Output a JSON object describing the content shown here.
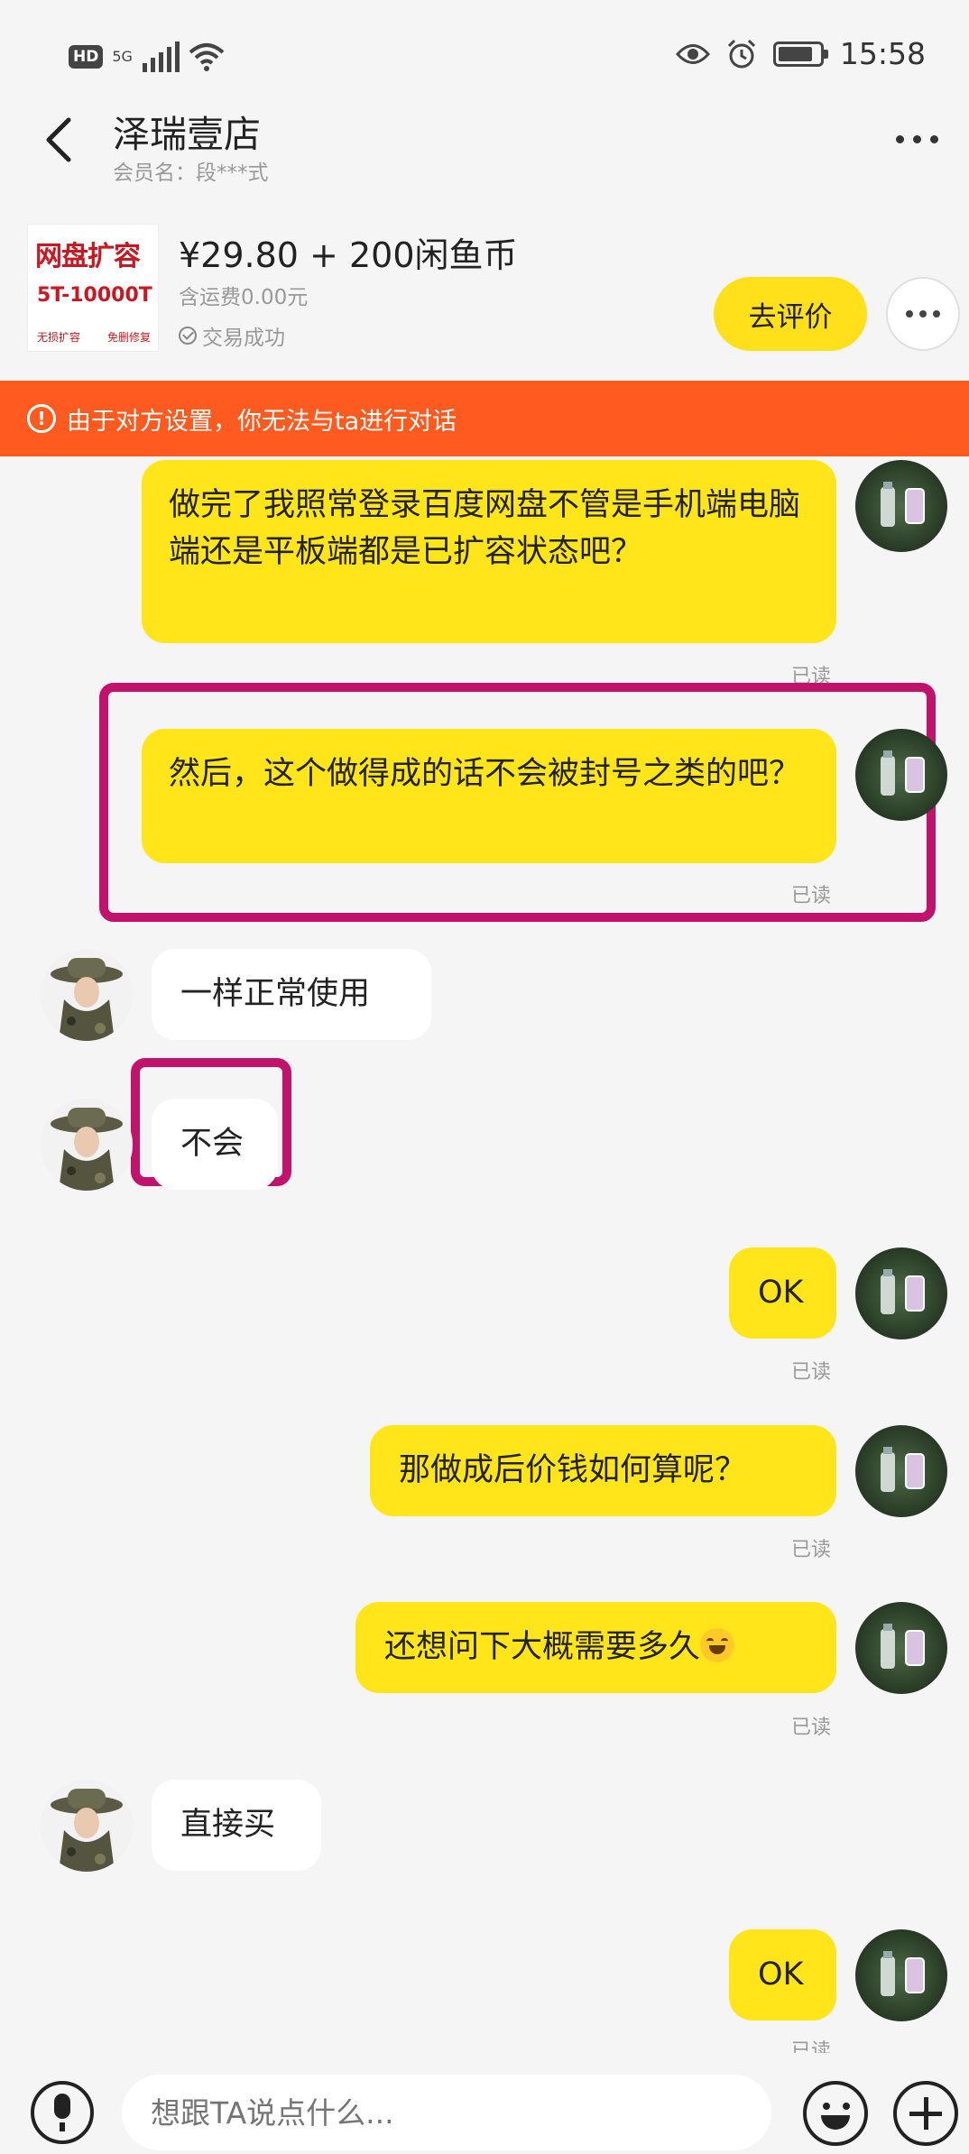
{
  "status_bar": {
    "hd": "HD",
    "network": "5G",
    "time": "15:58",
    "battery_level": 0.85
  },
  "header": {
    "title": "泽瑞壹店",
    "member_label": "会员名：段***式"
  },
  "product": {
    "thumb_title": "网盘扩容",
    "thumb_capacity": "5T-10000T",
    "thumb_left_note": "无损扩容",
    "thumb_right_note": "免删修复",
    "price": "¥29.80 + 200闲鱼币",
    "shipping": "含运费0.00元",
    "deal_status": "交易成功",
    "review_button": "去评价"
  },
  "banner": {
    "text": "由于对方设置，你无法与ta进行对话"
  },
  "messages": [
    {
      "side": "me",
      "text": "做完了我照常登录百度网盘不管是手机端电脑端还是平板端都是已扩容状态吧？",
      "status": "已读"
    },
    {
      "side": "me",
      "text": "然后，这个做得成的话不会被封号之类的吧？",
      "status": "已读"
    },
    {
      "side": "other",
      "text": "一样正常使用"
    },
    {
      "side": "other",
      "text": "不会"
    },
    {
      "side": "me",
      "text": "OK",
      "status": "已读"
    },
    {
      "side": "me",
      "text": "那做成后价钱如何算呢？",
      "status": "已读"
    },
    {
      "side": "me",
      "text": "还想问下大概需要多久",
      "status": "已读",
      "emoji": "tears-of-joy"
    },
    {
      "side": "other",
      "text": "直接买"
    },
    {
      "side": "me",
      "text": "OK",
      "status": "已读"
    }
  ],
  "input": {
    "placeholder": "想跟TA说点什么..."
  },
  "colors": {
    "accent": "#ffe51a",
    "banner": "#ff5a1f",
    "highlight": "#c2136c"
  }
}
